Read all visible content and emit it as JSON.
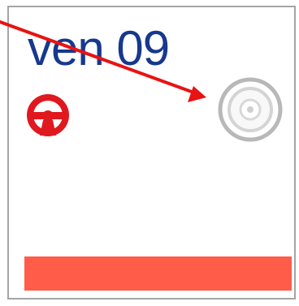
{
  "day": {
    "label": "ven 09"
  },
  "icons": {
    "left": "steering-wheel-icon",
    "right": "radio-button-icon"
  },
  "colors": {
    "label_text": "#17388e",
    "wheel": "#e0191f",
    "status_bar": "#ff5c4a",
    "annotation_arrow": "#e81313",
    "radio_ring": "#b5b5b5"
  }
}
